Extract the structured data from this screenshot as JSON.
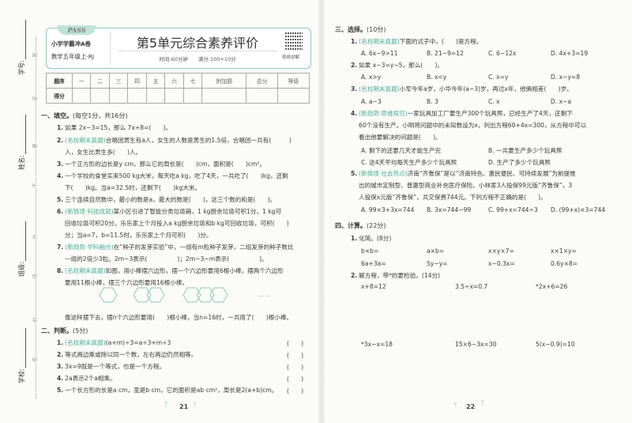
{
  "header": {
    "logo": "PASS",
    "series": "小学学霸冲A卷",
    "grade": "数学五年级上·RJ",
    "title": "第5单元综合素养评价",
    "time_info": "时间:60分钟　　满分:100+10分",
    "qr_label": "视频讲解"
  },
  "score_table": {
    "row1": [
      "题序",
      "一",
      "二",
      "三",
      "四",
      "五",
      "六",
      "七",
      "附加题",
      "总分",
      "等级"
    ],
    "row2_label": "得分"
  },
  "binding": {
    "fields": [
      "学号:",
      "姓名:",
      "班级:",
      "学校:"
    ],
    "seal_chars": [
      "题",
      "答",
      "要",
      "不",
      "内",
      "线",
      "封",
      "密"
    ]
  },
  "left": {
    "rows": [
      {
        "type": "heading",
        "text": "一、填空。",
        "sub": "(每空1分，共16分)"
      },
      {
        "type": "q",
        "num": "1.",
        "text": "如果 2x−3=15，那么 7x+8=(　　)。"
      },
      {
        "type": "q",
        "num": "2.",
        "tag": "(名校期末真题)",
        "text": "合唱团男生有a人，女生的人数是男生的1.5倍，合唱团一共有(　　　)"
      },
      {
        "type": "cont",
        "text": "人，女生比男生多(　　)人。"
      },
      {
        "type": "q",
        "num": "3.",
        "text": "一个正方形的边长是y cm，那么它的周长是(　　)cm，面积是(　　)cm²。"
      },
      {
        "type": "q",
        "num": "4.",
        "text": "一个学校的食堂买来500 kg大米，每天吃a kg，吃了4天，一共吃了(　　)kg，还剩"
      },
      {
        "type": "cont",
        "text": "下(　　)kg。当a=32.5时，还剩下(　　)kg大米。"
      },
      {
        "type": "q",
        "num": "5.",
        "text": "三个连续自然数中，最小的数是a，最大的数是(　　)，这三个数的和是(　　)。"
      },
      {
        "type": "q",
        "num": "6.",
        "tag": "(新情境·科技成就)",
        "text": "某小区引进了智能分类垃圾箱，1 kg厨余垃圾可积1分，1 kg可"
      },
      {
        "type": "cont",
        "text": "回收垃圾可积20分。乐乐家上个月投入a kg厨余垃圾和b kg可回收垃圾，可积(　　)"
      },
      {
        "type": "cont",
        "text": "分；当a=7，b=11.5时，乐乐家上个月可积(　　)分。"
      },
      {
        "type": "q",
        "num": "7.",
        "tag": "(新趋势·学科融合)",
        "text": "在“种子的发芽实验”中，一组有m粒种子发芽，二组发芽的种子数比"
      },
      {
        "type": "cont",
        "text": "一组的2倍少3粒。2m−3表示(　　　　　)；2m−3−m表示(　　　　　)。"
      },
      {
        "type": "q",
        "num": "8.",
        "tag": "(名校期末真题)",
        "text": "如图，用小棒摆六边形，摆一个六边形要用6根小棒，摆两个六边形"
      },
      {
        "type": "cont",
        "text": "要用11根小棒，摆三个六边形要用16根小棒。"
      },
      {
        "type": "cont2",
        "text": "像这样摆下去，摆n个六边形要用(　　)根小棒，当n=16时，一共用了(　　)根小棒。"
      },
      {
        "type": "heading",
        "text": "二、判断。",
        "sub": "(5分)"
      },
      {
        "type": "q",
        "num": "1.",
        "tag": "(名校期末真题)",
        "text": "(a+m)÷3=a÷3+m÷3",
        "paren": "(　　)"
      },
      {
        "type": "q",
        "num": "2.",
        "text": "等式两边乘或除以同一个数，左右两边仍然相等。",
        "paren": "(　　)"
      },
      {
        "type": "q",
        "num": "3.",
        "text": "3x=9既是一个等式，也是一个方程。",
        "paren": "(　　)"
      },
      {
        "type": "q",
        "num": "4.",
        "text": "2a表示2个a相乘。",
        "paren": "(　　)"
      },
      {
        "type": "q",
        "num": "5.",
        "text": "一个长方形的长是a cm，宽是b cm，它的面积是ab cm²，周长是2(a+b)cm。",
        "paren": "(　　)"
      }
    ],
    "figure_ellipsis": "……",
    "page_number": "21"
  },
  "right": {
    "rows": [
      {
        "type": "heading",
        "text": "三、选择。",
        "sub": "(10分)"
      },
      {
        "type": "q",
        "num": "1.",
        "tag": "(名校期末真题)",
        "text": "下面的式子中，(　　)是方程。"
      },
      {
        "type": "opts4",
        "options": [
          "A. 6x−9>11",
          "B. 21−9=12",
          "C. 6−12x",
          "D. 4x+3=19"
        ]
      },
      {
        "type": "q",
        "num": "2.",
        "text": "如果 x−3=y−5，那么(　　)。"
      },
      {
        "type": "opts4",
        "options": [
          "A. x>y",
          "B. x<y",
          "C. x=y",
          "D. x−y=8"
        ]
      },
      {
        "type": "q",
        "num": "3.",
        "tag": "(名校期末真题)",
        "text": "小军今年a岁，小华今年(a−3)岁，再过x年，他俩相差(　　)岁。"
      },
      {
        "type": "opts4",
        "options": [
          "A. a−3",
          "B. 3",
          "C. x",
          "D. x−a"
        ]
      },
      {
        "type": "q",
        "num": "4.",
        "tag": "(新趋势·思维探究)",
        "text": "一家玩具加工厂要生产300个玩具熊，已经生产了4天，还剩下"
      },
      {
        "type": "cont",
        "text": "60个没有生产。小明将问题中的未知数设为x，列出方程60+4x=300，从方程中可以"
      },
      {
        "type": "cont",
        "text": "看出他要解决的问题是(　　)。"
      },
      {
        "type": "opts2",
        "options": [
          "A. 剩下的还要几天才能生产完",
          "B. 一共要生产多少个玩具熊"
        ]
      },
      {
        "type": "opts2",
        "options": [
          "C. 这4天平均每天生产多少个玩具熊",
          "D. 生产了多少个玩具熊"
        ]
      },
      {
        "type": "q",
        "num": "5.",
        "tag": "(新情境·社会热点)",
        "text": "济南“齐鲁保”是以“济南特色、惠民便民、可持续发展”为前提推"
      },
      {
        "type": "cont",
        "text": "出的城市定制型、普惠型商业补充医疗保险。小林家3人投保99元版“齐鲁保”，3"
      },
      {
        "type": "cont",
        "text": "人投保x元版“齐鲁保”，共交保费744元。下列方程不正确的是(　　)。"
      },
      {
        "type": "opts4",
        "options": [
          "A. 99×3+3x=744",
          "B. 3x=744−99",
          "C. 99+x=744÷3",
          "D. (99+x)×3=744"
        ]
      },
      {
        "type": "heading",
        "text": "四、计算。",
        "sub": "(22分)"
      },
      {
        "type": "q",
        "num": "1.",
        "text": "化简。(8分)"
      },
      {
        "type": "opts4",
        "options": [
          "b×b=",
          "a×b=",
          "x×y×7=",
          "x×1×y="
        ]
      },
      {
        "type": "opts4",
        "options": [
          "6a+3a=",
          "5y−y=",
          "x−0.3x=",
          "0.6y×8="
        ]
      },
      {
        "type": "q",
        "num": "2.",
        "text": "解方程，带*的要检验。(14分)"
      },
      {
        "type": "opts3",
        "options": [
          "x+8=12",
          "3.5÷x=0.7",
          "*2x+6=26"
        ]
      },
      {
        "type": "opts3",
        "options": [
          "*3x−x=18",
          "15×6−3x=30",
          "5(x−0.9)=10"
        ]
      }
    ],
    "page_number": "22"
  }
}
